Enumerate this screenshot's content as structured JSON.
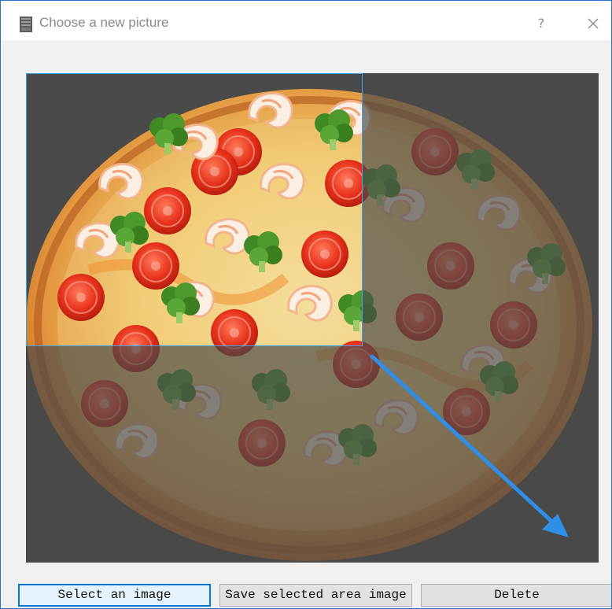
{
  "window": {
    "title": "Choose a new picture",
    "help_label": "?",
    "app_icon": "picture-frame-icon",
    "close_icon": "close-icon"
  },
  "canvas": {
    "image_subject": "shrimp-broccoli-tomato-pizza",
    "selection_state": "top-left region selected, remainder dimmed",
    "drag_arrow_icon": "resize-arrow-icon",
    "colors": {
      "dim_overlay": "#4a4a4a",
      "selection_border": "#3ba4f0",
      "arrow": "#2f8fe6"
    }
  },
  "buttons": {
    "select_image": "Select an image",
    "save_selected": "Save selected area image",
    "delete": "Delete"
  }
}
